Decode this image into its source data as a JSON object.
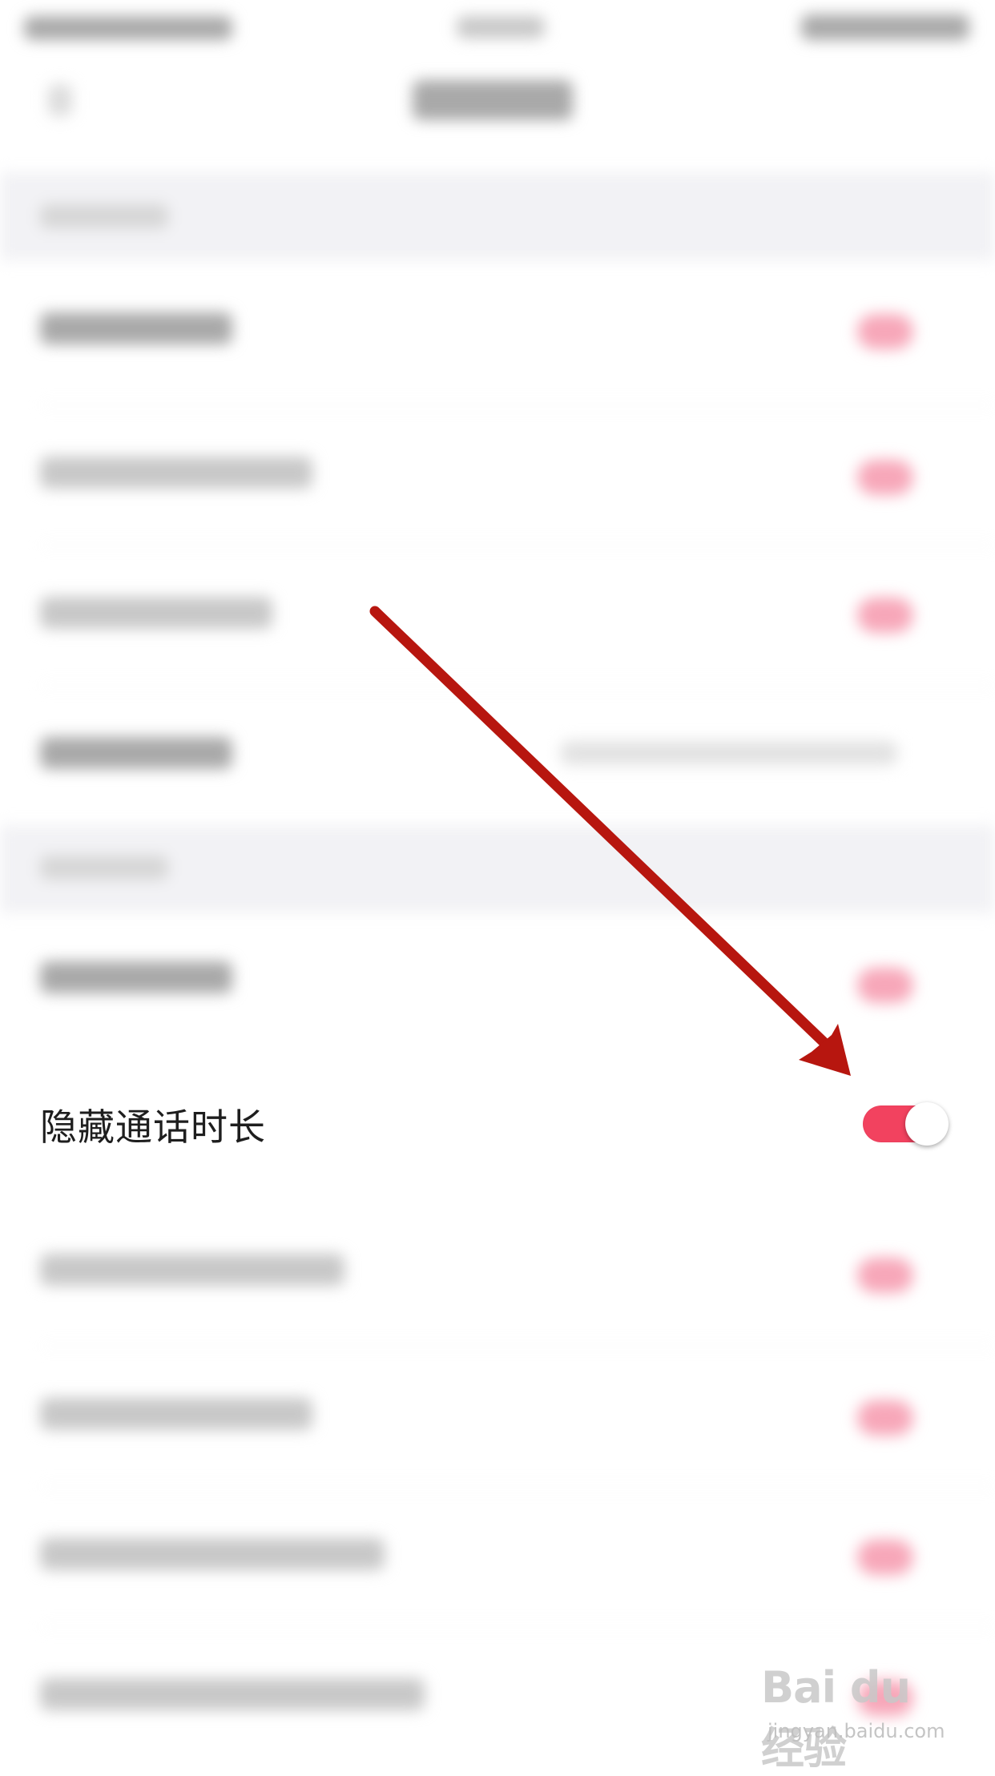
{
  "settings": {
    "highlighted_row": {
      "label": "隐藏通话时长",
      "toggle_on": true
    }
  },
  "colors": {
    "toggle_on": "#f2425f",
    "arrow": "#b7160f",
    "section_band": "#f2f2f5"
  },
  "watermark": {
    "brand": "Bai du 经验",
    "url": "jingyan.baidu.com"
  }
}
